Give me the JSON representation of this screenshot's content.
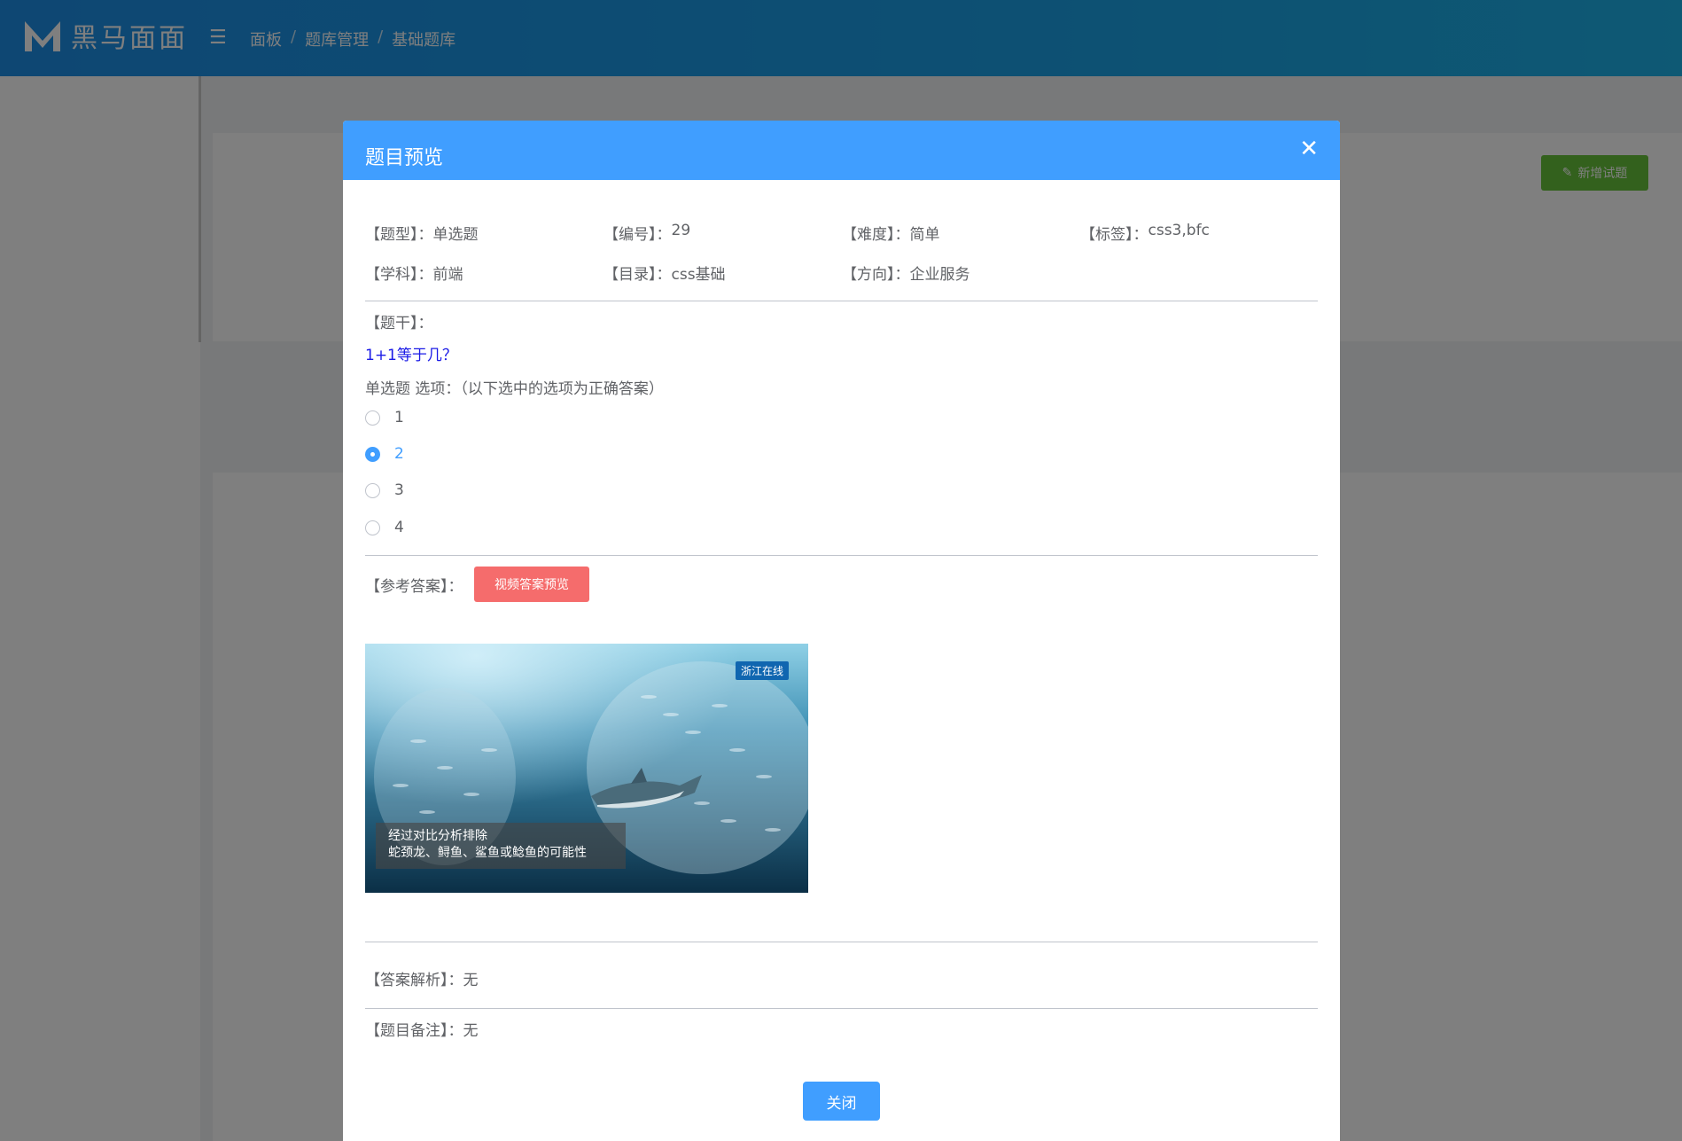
{
  "app": {
    "logo_text": "黑马面面"
  },
  "breadcrumb": [
    "面板",
    "题库管理",
    "基础题库"
  ],
  "toolbar": {
    "add_question_label": "新增试题"
  },
  "dialog": {
    "title": "题目预览",
    "meta": {
      "type": {
        "label": "【题型】：",
        "value": "单选题"
      },
      "number": {
        "label": "【编号】：",
        "value": "29"
      },
      "difficulty": {
        "label": "【难度】：",
        "value": "简单"
      },
      "tags": {
        "label": "【标签】：",
        "value": "css3,bfc"
      },
      "subject": {
        "label": "【学科】：",
        "value": "前端"
      },
      "catalog": {
        "label": "【目录】：",
        "value": "css基础"
      },
      "direction": {
        "label": "【方向】：",
        "value": "企业服务"
      }
    },
    "stem_label": "【题干】：",
    "stem_text": "1+1等于几？",
    "options_title": "单选题 选项：（以下选中的选项为正确答案）",
    "options": [
      {
        "label": "1",
        "checked": false
      },
      {
        "label": "2",
        "checked": true
      },
      {
        "label": "3",
        "checked": false
      },
      {
        "label": "4",
        "checked": false
      }
    ],
    "reference_label": "【参考答案】：",
    "video_preview_label": "视频答案预览",
    "video": {
      "watermark": "浙江在线",
      "caption_line1": "经过对比分析排除",
      "caption_line2": "蛇颈龙、鲟鱼、鲨鱼或鲶鱼的可能性"
    },
    "analysis": {
      "label": "【答案解析】：",
      "value": "无"
    },
    "remark": {
      "label": "【题目备注】：",
      "value": "无"
    },
    "close_label": "关闭"
  },
  "colors": {
    "primary": "#409eff",
    "danger": "#f56c6c",
    "success": "#67c23a",
    "stem": "#1a1ae6"
  }
}
